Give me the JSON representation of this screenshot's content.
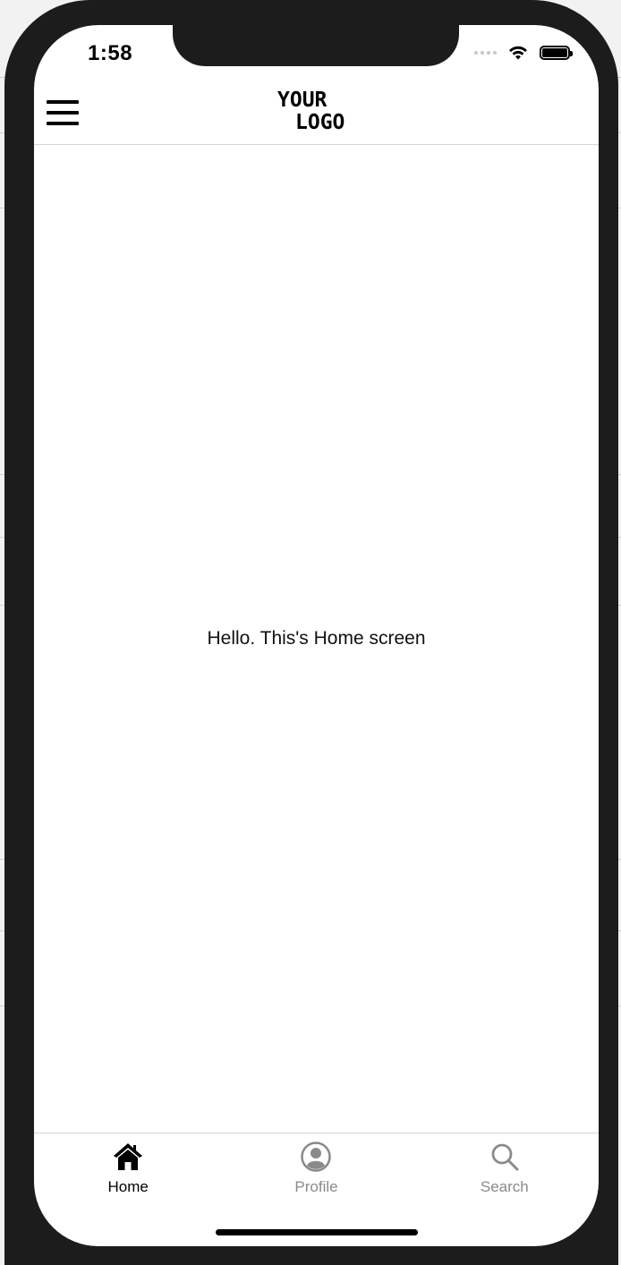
{
  "status_bar": {
    "time": "1:58"
  },
  "header": {
    "logo_line1": "YOUR",
    "logo_line2": "LOGO",
    "menu_icon": "hamburger-icon"
  },
  "main": {
    "message": "Hello. This's Home screen"
  },
  "tab_bar": {
    "active_color": "#000000",
    "inactive_color": "#8a8a8a",
    "tabs": [
      {
        "label": "Home",
        "icon": "home-icon",
        "active": true
      },
      {
        "label": "Profile",
        "icon": "profile-icon",
        "active": false
      },
      {
        "label": "Search",
        "icon": "search-icon",
        "active": false
      }
    ]
  }
}
